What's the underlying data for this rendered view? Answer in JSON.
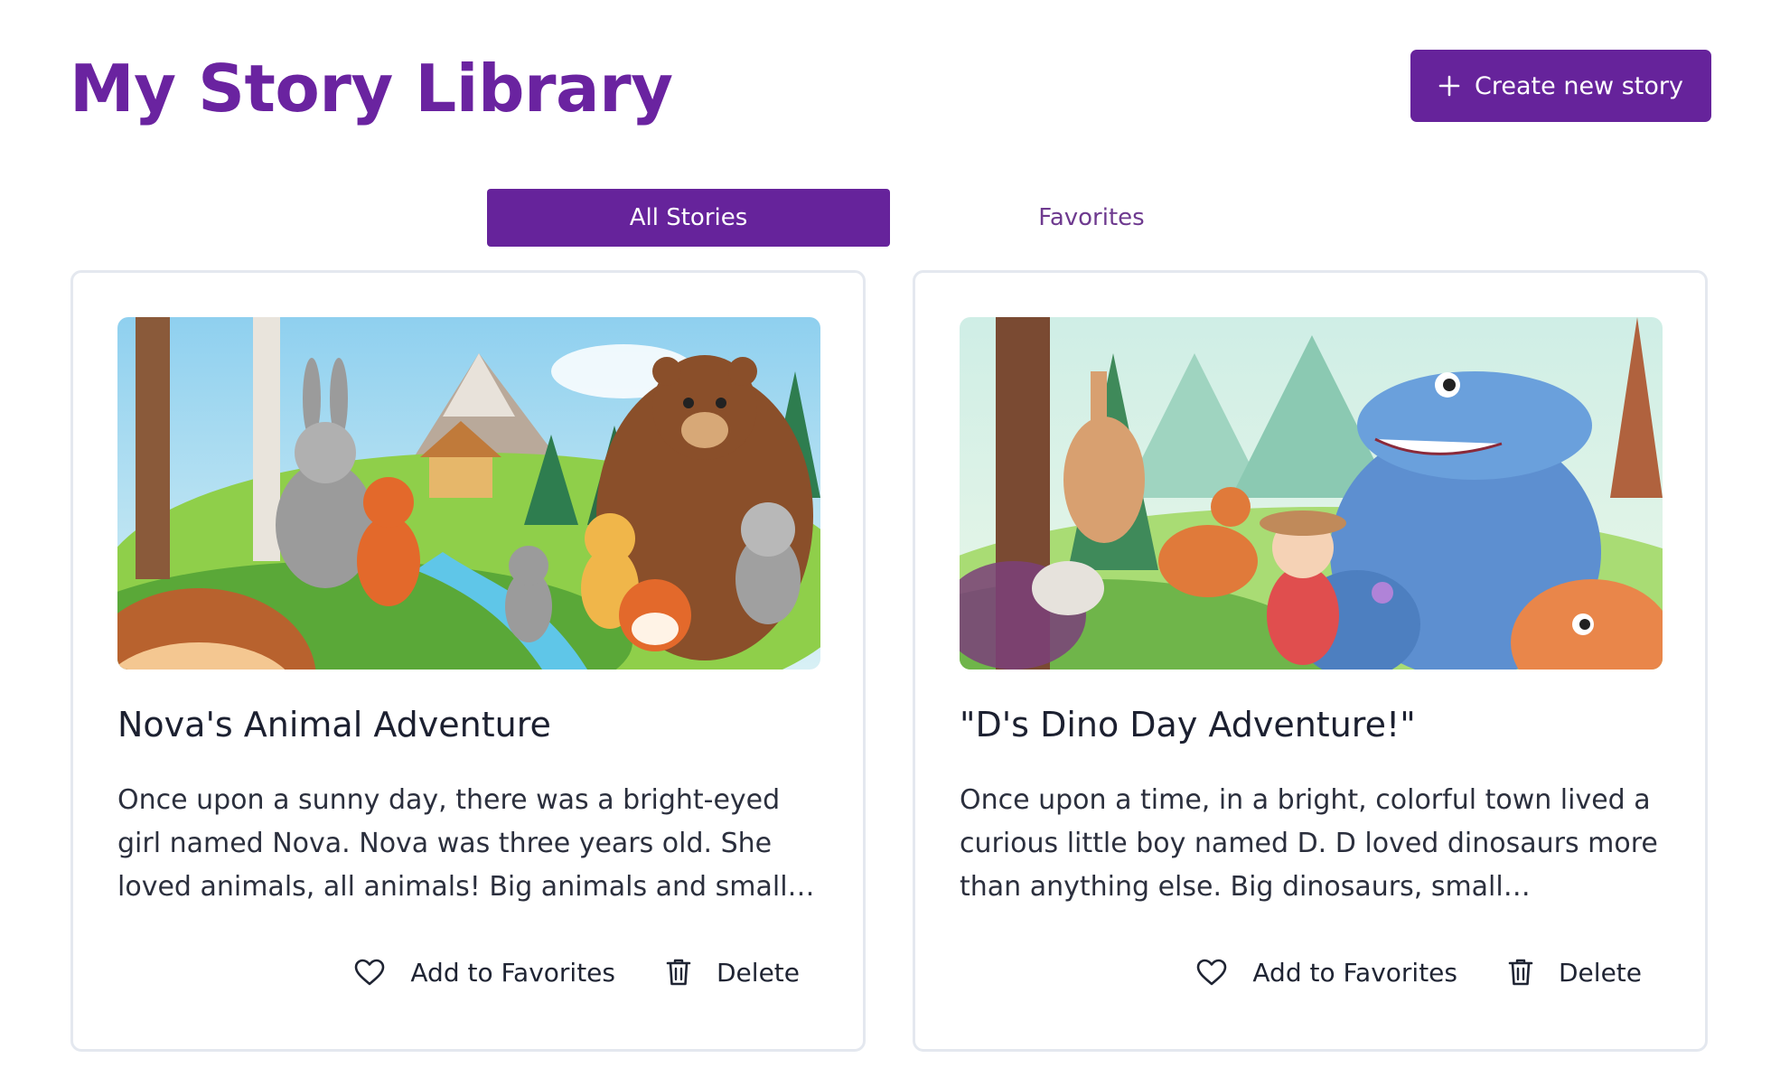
{
  "header": {
    "title": "My Story Library",
    "create_button_label": "Create new story"
  },
  "tabs": [
    {
      "label": "All Stories",
      "active": true
    },
    {
      "label": "Favorites",
      "active": false
    }
  ],
  "stories": [
    {
      "title": "Nova's Animal Adventure",
      "excerpt": "Once upon a sunny day, there was a bright-eyed girl named Nova. Nova was three years old. She loved animals, all animals! Big animals and small animals....",
      "image": "illustration of a bear, fox, rabbits and squirrels in a forest meadow",
      "favorite_label": "Add to Favorites",
      "delete_label": "Delete"
    },
    {
      "title": "\"D's Dino Day Adventure!\"",
      "excerpt": "Once upon a time, in a bright, colorful town lived a curious little boy named D. D loved dinosaurs more than anything else. Big dinosaurs, small dinosaurs,...",
      "image": "illustration of dinosaurs in a jungle with a smiling child",
      "favorite_label": "Add to Favorites",
      "delete_label": "Delete"
    }
  ],
  "icons": {
    "create": "plus-icon",
    "favorite": "heart-outline-icon",
    "delete": "trash-icon"
  },
  "colors": {
    "brand": "#66239b",
    "title": "#6a23a0",
    "card_border": "#e4e8ef"
  }
}
